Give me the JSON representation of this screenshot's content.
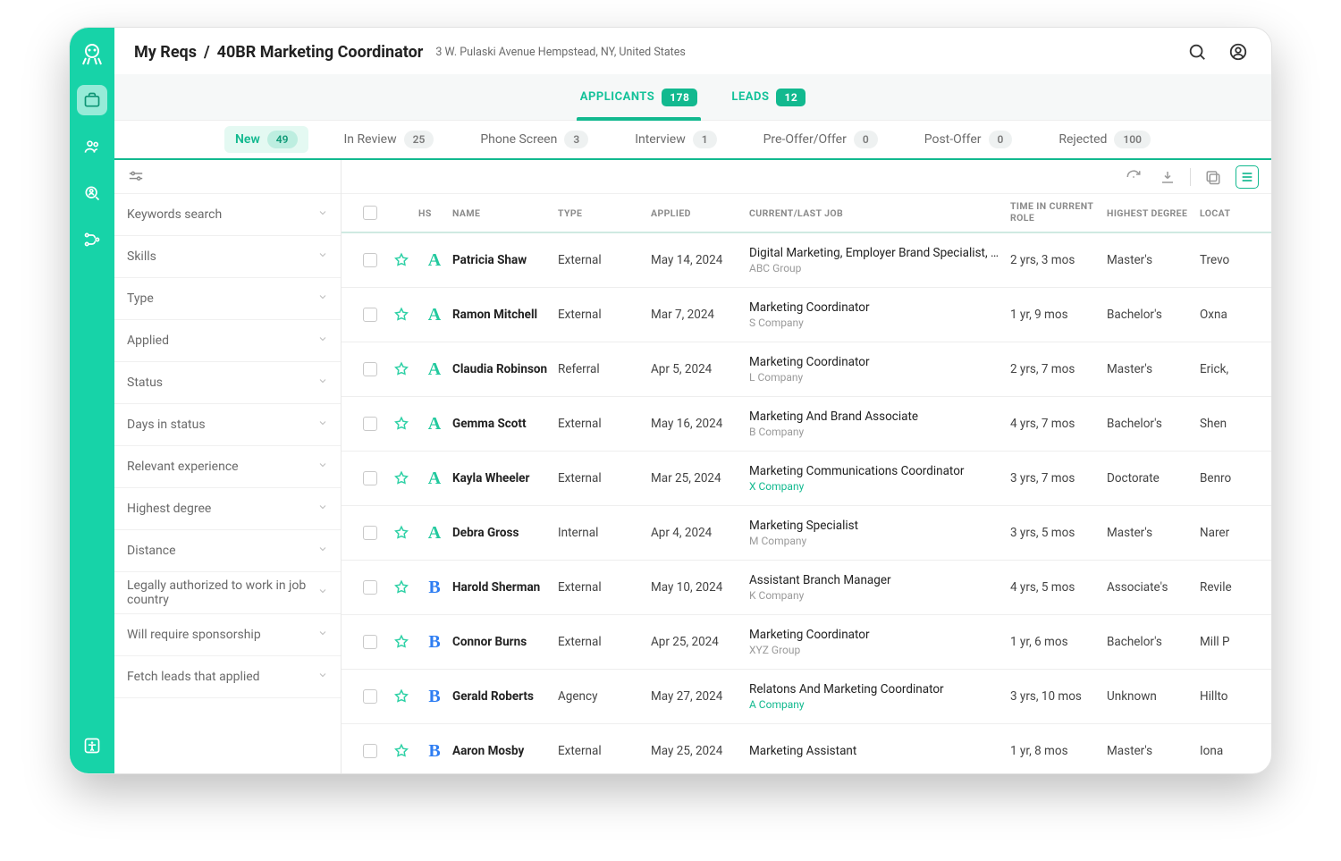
{
  "breadcrumb": {
    "root": "My Reqs",
    "sep": "/",
    "title": "40BR Marketing Coordinator"
  },
  "address": "3 W. Pulaski Avenue Hempstead, NY, United States",
  "tabs1": {
    "applicants": {
      "label": "APPLICANTS",
      "count": "178"
    },
    "leads": {
      "label": "LEADS",
      "count": "12"
    }
  },
  "tabs2": [
    {
      "label": "New",
      "count": "49",
      "active": true
    },
    {
      "label": "In Review",
      "count": "25"
    },
    {
      "label": "Phone Screen",
      "count": "3"
    },
    {
      "label": "Interview",
      "count": "1"
    },
    {
      "label": "Pre-Offer/Offer",
      "count": "0"
    },
    {
      "label": "Post-Offer",
      "count": "0"
    },
    {
      "label": "Rejected",
      "count": "100"
    }
  ],
  "filters": [
    "Keywords search",
    "Skills",
    "Type",
    "Applied",
    "Status",
    "Days in status",
    "Relevant experience",
    "Highest degree",
    "Distance",
    "Legally authorized to work in job country",
    "Will require sponsorship",
    "Fetch leads that applied"
  ],
  "columns": {
    "hs": "HS",
    "name": "NAME",
    "type": "TYPE",
    "applied": "APPLIED",
    "job": "CURRENT/LAST JOB",
    "time": "TIME IN CURRENT ROLE",
    "degree": "HIGHEST DEGREE",
    "location": "LOCAT"
  },
  "rows": [
    {
      "hs": "A",
      "hsClass": "hs-A",
      "name": "Patricia Shaw",
      "type": "External",
      "applied": "May 14, 2024",
      "job": "Digital Marketing, Employer Brand Specialist, A…",
      "company": "ABC Group",
      "coLink": false,
      "time": "2 yrs, 3 mos",
      "degree": "Master's",
      "loc": "Trevo"
    },
    {
      "hs": "A",
      "hsClass": "hs-A",
      "name": "Ramon Mitchell",
      "type": "External",
      "applied": "Mar 7, 2024",
      "job": "Marketing Coordinator",
      "company": "S Company",
      "coLink": false,
      "time": "1 yr, 9 mos",
      "degree": "Bachelor's",
      "loc": "Oxna"
    },
    {
      "hs": "A",
      "hsClass": "hs-A",
      "name": "Claudia Robinson",
      "type": "Referral",
      "applied": "Apr 5, 2024",
      "job": "Marketing Coordinator",
      "company": "L Company",
      "coLink": false,
      "time": "2 yrs, 7 mos",
      "degree": "Master's",
      "loc": "Erick,"
    },
    {
      "hs": "A",
      "hsClass": "hs-A",
      "name": "Gemma Scott",
      "type": "External",
      "applied": "May 16, 2024",
      "job": "Marketing And Brand Associate",
      "company": "B Company",
      "coLink": false,
      "time": "4 yrs, 7 mos",
      "degree": "Bachelor's",
      "loc": "Shen"
    },
    {
      "hs": "A",
      "hsClass": "hs-A",
      "name": "Kayla Wheeler",
      "type": "External",
      "applied": "Mar 25, 2024",
      "job": "Marketing Communications Coordinator",
      "company": "X Company",
      "coLink": true,
      "time": "3 yrs, 7 mos",
      "degree": "Doctorate",
      "loc": "Benro"
    },
    {
      "hs": "A",
      "hsClass": "hs-A",
      "name": "Debra Gross",
      "type": "Internal",
      "applied": "Apr 4, 2024",
      "job": "Marketing Specialist",
      "company": "M Company",
      "coLink": false,
      "time": "3 yrs, 5 mos",
      "degree": "Master's",
      "loc": "Narer"
    },
    {
      "hs": "B",
      "hsClass": "hs-B",
      "name": "Harold Sherman",
      "type": "External",
      "applied": "May 10, 2024",
      "job": "Assistant Branch Manager",
      "company": "K Company",
      "coLink": false,
      "time": "4 yrs, 5 mos",
      "degree": "Associate's",
      "loc": "Revile"
    },
    {
      "hs": "B",
      "hsClass": "hs-B",
      "name": "Connor Burns",
      "type": "External",
      "applied": "Apr 25, 2024",
      "job": "Marketing Coordinator",
      "company": "XYZ Group",
      "coLink": false,
      "time": "1 yr, 6 mos",
      "degree": "Bachelor's",
      "loc": "Mill P"
    },
    {
      "hs": "B",
      "hsClass": "hs-B",
      "name": "Gerald Roberts",
      "type": "Agency",
      "applied": "May 27, 2024",
      "job": "Relatons And Marketing Coordinator",
      "company": "A Company",
      "coLink": true,
      "time": "3 yrs, 10 mos",
      "degree": "Unknown",
      "loc": "Hillto"
    },
    {
      "hs": "B",
      "hsClass": "hs-B",
      "name": "Aaron Mosby",
      "type": "External",
      "applied": "May 25, 2024",
      "job": "Marketing Assistant",
      "company": "",
      "coLink": false,
      "time": "1 yr, 8 mos",
      "degree": "Master's",
      "loc": "Iona"
    }
  ]
}
